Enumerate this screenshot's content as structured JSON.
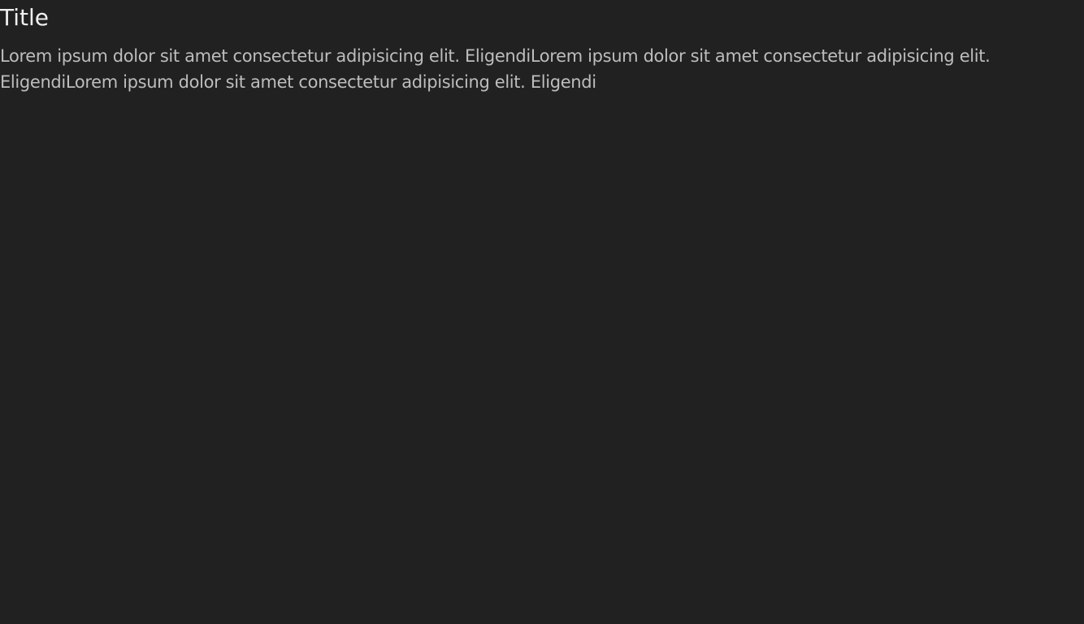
{
  "page": {
    "title": "Title",
    "body": "Lorem ipsum dolor sit amet consectetur adipisicing elit. EligendiLorem ipsum dolor sit amet consectetur adipisicing elit. EligendiLorem ipsum dolor sit amet consectetur adipisicing elit. Eligendi"
  },
  "colors": {
    "background": "#212121",
    "title": "#f0f0f0",
    "body_text": "#bdbdbd"
  }
}
